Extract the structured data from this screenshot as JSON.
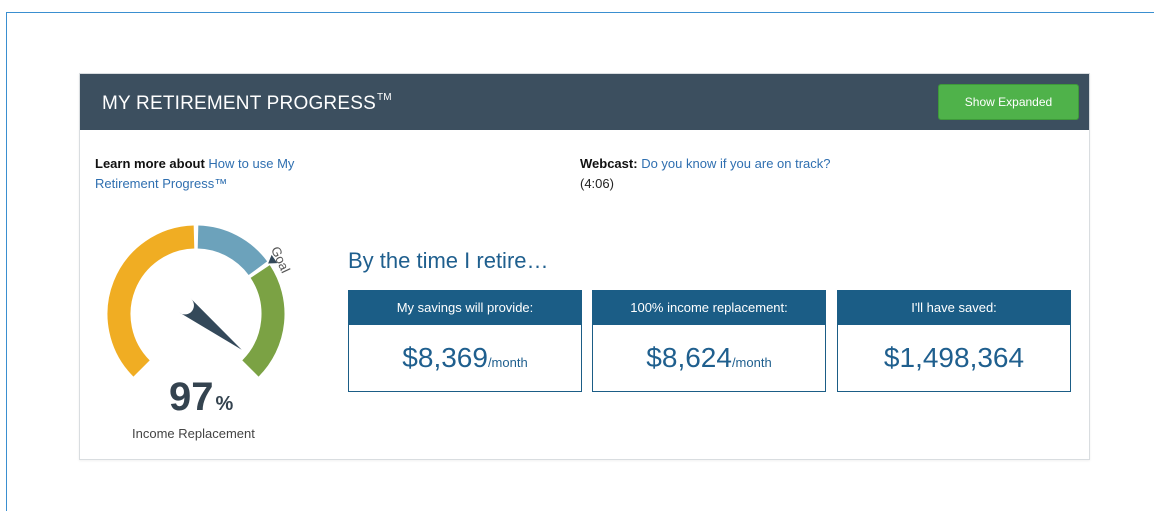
{
  "header": {
    "title": "MY RETIREMENT PROGRESS",
    "trademark": "TM",
    "expand_button": "Show Expanded"
  },
  "learn_more": {
    "label": "Learn more about",
    "link_text": "How to use My Retirement Progress™"
  },
  "webcast": {
    "label": "Webcast:",
    "link_text": "Do you know if you are on track?",
    "duration": "(4:06)"
  },
  "gauge": {
    "goal_label": "Goal",
    "percent_value": "97",
    "percent_symbol": "%",
    "percent": 97,
    "caption": "Income Replacement",
    "colors": {
      "current": "#f0ad23",
      "remaining": "#6ca2bb",
      "above_goal": "#7ba244",
      "needle": "#34495a"
    }
  },
  "summary": {
    "heading": "By the time I retire…",
    "cards": [
      {
        "label": "My savings will provide:",
        "value": "$8,369",
        "unit": "/month"
      },
      {
        "label": "100% income replacement:",
        "value": "$8,624",
        "unit": "/month"
      },
      {
        "label": "I'll have saved:",
        "value": "$1,498,364",
        "unit": ""
      }
    ]
  }
}
